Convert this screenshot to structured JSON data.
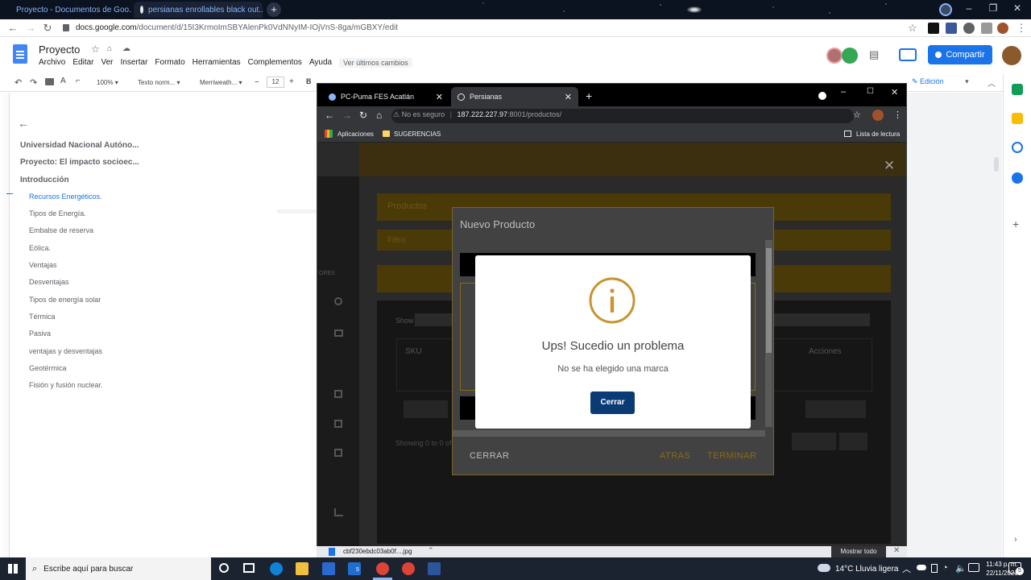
{
  "outer_browser": {
    "tabs": [
      {
        "label": "Proyecto - Documentos de Goo..."
      },
      {
        "label": "persianas enrollables black out..."
      }
    ],
    "url_host": "docs.google.com",
    "url_path": "/document/d/15I3KrmoImSBYAlenPk0VdNNyIM-IOjVnS-8ga/mGBXY/edit"
  },
  "docs": {
    "title": "Proyecto",
    "menu": [
      "Archivo",
      "Editar",
      "Ver",
      "Insertar",
      "Formato",
      "Herramientas",
      "Complementos",
      "Ayuda"
    ],
    "last_edit": "Ver últimos cambios",
    "share_label": "Compartir",
    "toolbar": {
      "zoom": "100%",
      "style": "Texto norm...",
      "font": "Merriweath...",
      "size": "12",
      "mode": "Edición"
    },
    "outline": [
      {
        "label": "Universidad Nacional Autóno...",
        "level": 1
      },
      {
        "label": "Proyecto: El impacto socioec...",
        "level": 1
      },
      {
        "label": "Introducción",
        "level": 1
      },
      {
        "label": "Recursos Energéticos.",
        "level": 2,
        "active": true
      },
      {
        "label": "Tipos de Energía.",
        "level": 2
      },
      {
        "label": "Embalse de reserva",
        "level": 2
      },
      {
        "label": "Eólica.",
        "level": 2
      },
      {
        "label": "Ventajas",
        "level": 2
      },
      {
        "label": "Desventajas",
        "level": 2
      },
      {
        "label": "Tipos de energía solar",
        "level": 2
      },
      {
        "label": "Térmica",
        "level": 2
      },
      {
        "label": "Pasiva",
        "level": 2
      },
      {
        "label": "ventajas y desventajas",
        "level": 2
      },
      {
        "label": "Geotérmica",
        "level": 2
      },
      {
        "label": "Fisión y fusión nuclear.",
        "level": 2
      }
    ]
  },
  "inner_browser": {
    "tabs": [
      {
        "label": "PC-Puma FES Acatlán"
      },
      {
        "label": "Persianas"
      }
    ],
    "security": "No es seguro",
    "url_host": "187.222.227.97",
    "url_rest": ":8001/productos/",
    "bookmarks": [
      "Aplicaciones",
      "SUGERENCIAS"
    ],
    "reading_list": "Lista de lectura",
    "page": {
      "header": "Productos",
      "filter": "Filtro",
      "show": "Show",
      "col_sku": "SKU",
      "col_actions": "Acciones",
      "showing": "Showing 0 to 0 of 0 entries",
      "sidebar_label": "ORES"
    },
    "modal": {
      "title": "Nuevo Producto",
      "close": "CERRAR",
      "back": "ATRAS",
      "finish": "TERMINAR"
    },
    "alert": {
      "title": "Ups! Sucedio un problema",
      "text": "No se ha elegido una marca",
      "button": "Cerrar"
    },
    "download": {
      "file": "cbf230ebdc03ab0f....jpg",
      "show_all": "Mostrar todo"
    }
  },
  "taskbar": {
    "search_placeholder": "Escribe aquí para buscar",
    "weather": "14°C  Lluvia ligera",
    "time": "11:43 p. m.",
    "date": "22/11/2021",
    "notif_count": "5",
    "mail_badge": "5"
  },
  "colors": {
    "docs_blue": "#1a73e8",
    "alert_info": "#c89432",
    "alert_button": "#0b3b75",
    "page_gold": "#8a6a14"
  }
}
